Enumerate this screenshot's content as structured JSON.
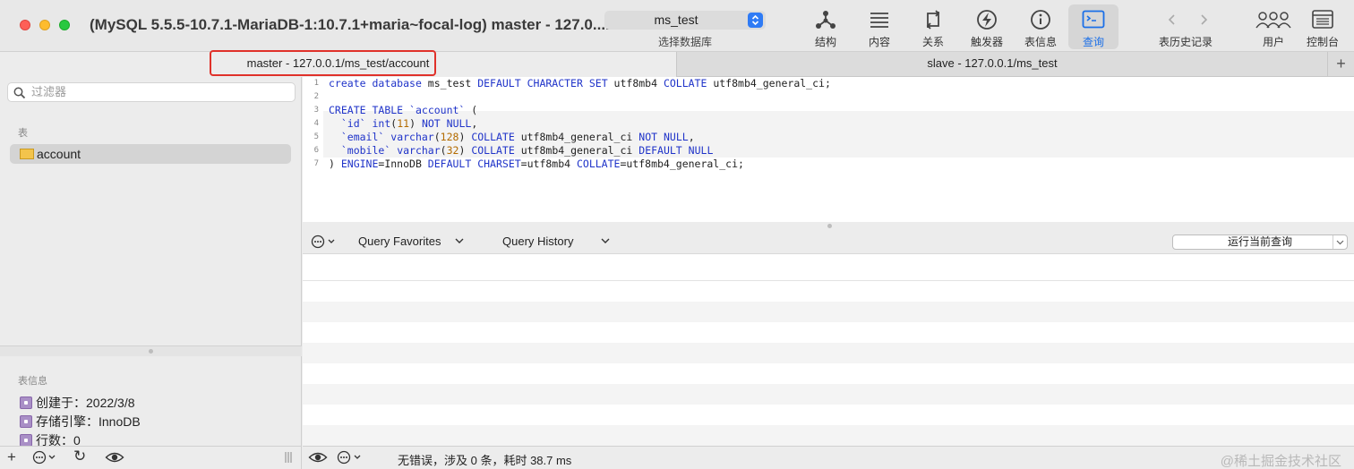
{
  "window": {
    "title": "(MySQL 5.5.5-10.7.1-MariaDB-1:10.7.1+maria~focal-log) master - 127.0...."
  },
  "toolbar": {
    "database": "ms_test",
    "database_label": "选择数据库",
    "buttons": [
      {
        "label": "结构",
        "icon": "structure-icon"
      },
      {
        "label": "内容",
        "icon": "content-icon"
      },
      {
        "label": "关系",
        "icon": "relations-icon"
      },
      {
        "label": "触发器",
        "icon": "triggers-icon"
      },
      {
        "label": "表信息",
        "icon": "info-icon"
      },
      {
        "label": "查询",
        "icon": "terminal-icon",
        "active": true
      }
    ],
    "history_label": "表历史记录",
    "users_label": "用户",
    "console_label": "控制台"
  },
  "tabs": {
    "master": "master - 127.0.0.1/ms_test/account",
    "slave": "slave - 127.0.0.1/ms_test",
    "add": "+"
  },
  "sidebar": {
    "filter_placeholder": "过滤器",
    "tables_heading": "表",
    "tables": [
      "account"
    ],
    "info_heading": "表信息",
    "info": [
      "创建于：2022/3/8",
      "存储引擎：InnoDB",
      "行数：0"
    ],
    "bottom": {
      "add": "+",
      "refresh": "↻"
    }
  },
  "editor": {
    "line_numbers": [
      "1",
      "2",
      "3",
      "4",
      "5",
      "6",
      "7"
    ],
    "lines": [
      "create database ms_test DEFAULT CHARACTER SET utf8mb4 COLLATE utf8mb4_general_ci;",
      "",
      "CREATE TABLE `account` (",
      "  `id` int(11) NOT NULL,",
      "  `email` varchar(128) COLLATE utf8mb4_general_ci NOT NULL,",
      "  `mobile` varchar(32) COLLATE utf8mb4_general_ci DEFAULT NULL",
      ") ENGINE=InnoDB DEFAULT CHARSET=utf8mb4 COLLATE=utf8mb4_general_ci;"
    ]
  },
  "querybar": {
    "favorites": "Query Favorites",
    "history": "Query History",
    "run": "运行当前查询"
  },
  "status": {
    "text": "无错误，涉及 0 条，耗时 38.7 ms",
    "watermark": "@稀土掘金技术社区"
  },
  "colors": {
    "accent": "#1a6fe8",
    "highlight_box": "#e0312a",
    "keyword": "#1f33c9",
    "number": "#b36b00"
  }
}
